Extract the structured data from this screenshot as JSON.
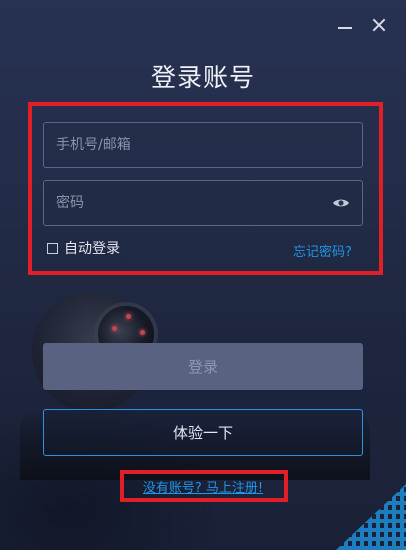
{
  "window": {
    "title": "登录账号"
  },
  "form": {
    "phone_placeholder": "手机号/邮箱",
    "password_placeholder": "密码",
    "password_icon": "eye-icon",
    "remember_label": "自动登录",
    "remember_checked": false,
    "forgot_label": "忘记密码?"
  },
  "actions": {
    "login_label": "登录",
    "try_label": "体验一下",
    "register_label": "没有账号? 马上注册!"
  },
  "colors": {
    "accent": "#1f96e8",
    "highlight": "#e01f26",
    "background": "#232c44"
  }
}
